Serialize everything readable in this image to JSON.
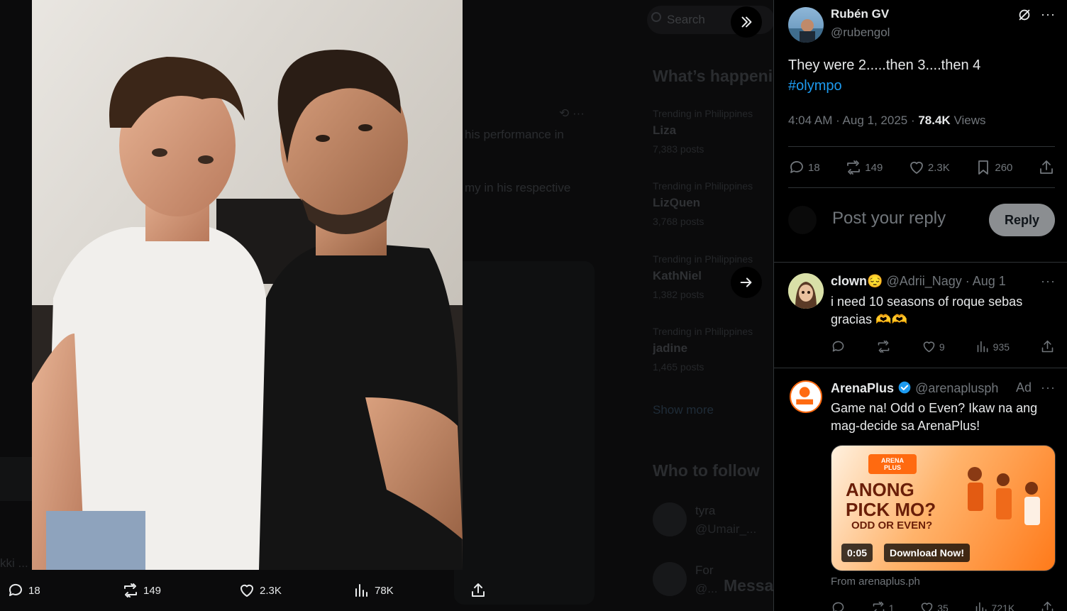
{
  "background": {
    "search_placeholder": "Search",
    "whats_happening": "What’s happening",
    "trends": [
      {
        "context": "Trending in Philippines",
        "name": "Liza",
        "posts": "7,383 posts"
      },
      {
        "context": "Trending in Philippines",
        "name": "LizQuen",
        "posts": "3,768 posts"
      },
      {
        "context": "Trending in Philippines",
        "name": "KathNiel",
        "posts": "1,382 posts"
      },
      {
        "context": "Trending in Philippines",
        "name": "jadine",
        "posts": "1,465 posts"
      }
    ],
    "show_more": "Show more",
    "who_to_follow": "Who to follow",
    "follow_suggestions": [
      {
        "name": "tyra",
        "handle": "@Umair_..."
      },
      {
        "name": "For",
        "handle": "@..."
      }
    ],
    "messages": "Messa",
    "timeline_fragments": [
      "his performance in",
      "my in his respective",
      "kki ..."
    ]
  },
  "media_bar": {
    "replies": "18",
    "reposts": "149",
    "likes": "2.3K",
    "views": "78K"
  },
  "main_post": {
    "author_name": "Rubén GV",
    "author_handle": "@rubengol",
    "text_line1": "They were 2.....then 3....then 4",
    "hashtag": "#olympo",
    "time": "4:04 AM · Aug 1, 2025 · ",
    "views_count": "78.4K",
    "views_label": " Views",
    "stats": {
      "replies": "18",
      "reposts": "149",
      "likes": "2.3K",
      "bookmarks": "260"
    }
  },
  "reply_box": {
    "placeholder": "Post your reply",
    "button_label": "Reply"
  },
  "replies": [
    {
      "name": "clown",
      "emoji": "😔",
      "handle": "@Adrii_Nagy",
      "date": "· Aug 1",
      "text_line1": "i need 10 seasons of roque sebas",
      "text_line2": "gracias 🫶🫶",
      "likes": "9",
      "views": "935"
    },
    {
      "name": "ArenaPlus",
      "handle": "@arenaplusph",
      "ad_label": "Ad",
      "text_line1": "Game na! Odd o Even? Ikaw na ang",
      "text_line2": "mag-decide sa ArenaPlus!",
      "card": {
        "logo_line1": "ARENA",
        "logo_line2": "PLUS",
        "headline_line1": "ANONG",
        "headline_line2": "PICK MO?",
        "subline": "ODD OR EVEN?",
        "duration": "0:05",
        "cta": "Download Now!"
      },
      "from": "From arenaplus.ph",
      "reposts": "1",
      "likes": "35",
      "views": "721K"
    }
  ],
  "colors": {
    "accent": "#1d9bf0",
    "muted": "#71767b",
    "text": "#e7e9ea",
    "border": "#2f3336",
    "verified": "#1d9bf0",
    "ad_orange": "#ff6a10"
  }
}
